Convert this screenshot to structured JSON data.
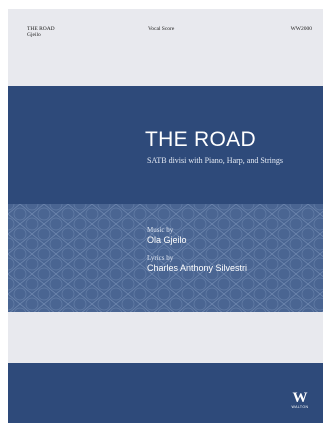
{
  "header": {
    "title_short": "THE ROAD",
    "composer_short": "Gjeilo",
    "score_type": "Vocal Score",
    "catalog_number": "WW2000"
  },
  "cover": {
    "title": "THE ROAD",
    "subtitle": "SATB divisi with Piano, Harp, and Strings",
    "music_label": "Music by",
    "music_name": "Ola Gjeilo",
    "lyrics_label": "Lyrics by",
    "lyrics_name": "Charles Anthony Silvestri"
  },
  "publisher": {
    "logo_mark": "W",
    "logo_text": "WALTON"
  },
  "colors": {
    "page_bg": "#ffffff",
    "cover_light": "#e8e9ee",
    "navy": "#2e4a7a",
    "pattern_blue": "#4a6592"
  }
}
